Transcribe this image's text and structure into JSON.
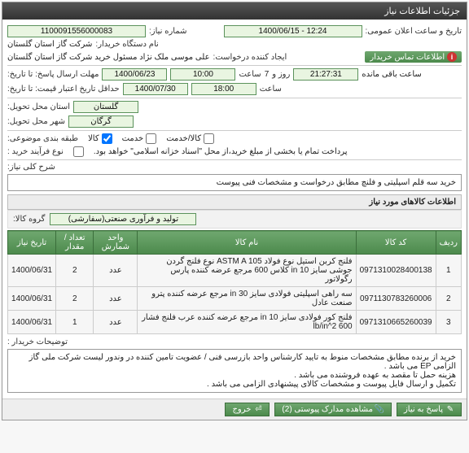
{
  "panel_title": "جزئیات اطلاعات نیاز",
  "fields": {
    "need_no_label": "شماره نیاز:",
    "need_no": "1100091556000083",
    "announce_label": "تاریخ و ساعت اعلان عمومی:",
    "announce_val": "1400/06/15 - 12:24",
    "buyer_org_label": "نام دستگاه خریدار:",
    "buyer_org": "شرکت گاز استان گلستان",
    "creator_label": "ایجاد کننده درخواست:",
    "creator": "علی موسی ملک نژاد مسئول خرید شرکت گاز استان گلستان",
    "contact_btn": "اطلاعات تماس خریدار",
    "reply_deadline_label": "مهلت ارسال پاسخ: تا تاریخ:",
    "reply_date": "1400/06/23",
    "time_label": "ساعت",
    "reply_time": "10:00",
    "day_label": "روز و",
    "days_left": "7",
    "countdown": "21:27:31",
    "remaining": "ساعت باقی مانده",
    "valid_label": "حداقل تاریخ اعتبار قیمت: تا تاریخ:",
    "valid_date": "1400/07/30",
    "valid_time": "18:00",
    "province_label": "استان محل تحویل:",
    "province": "گلستان",
    "city_label": "شهر محل تحویل:",
    "city": "گرگان",
    "classify_label": "طبقه بندی موضوعی:",
    "cb_goods": "کالا",
    "cb_service": "خدمت",
    "cb_both": "کالا/خدمت",
    "process_label": "نوع فرآیند خرید :",
    "process_note": "پرداخت تمام یا بخشی از مبلغ خرید،از محل \"اسناد خزانه اسلامی\" خواهد بود.",
    "desc_label": "شرح کلی نیاز:",
    "desc_text": "خرید سه قلم اسپلیتی و فلنچ مطابق درخواست و مشخصات فنی پیوست",
    "items_header": "اطلاعات کالاهای مورد نیاز",
    "group_label": "گروه کالا:",
    "group_val": "تولید و فرآوری صنعتی(سفارشی)"
  },
  "table": {
    "headers": {
      "row": "ردیف",
      "code": "کد کالا",
      "name": "نام کالا",
      "unit": "واحد شمارش",
      "qty": "تعداد / مقدار",
      "date": "تاریخ نیاز"
    },
    "rows": [
      {
        "idx": "1",
        "code": "0971310028400138",
        "name": "فلنج کربن استیل نوع فولاد ASTM A 105 نوع فلنج گردن جوشی سایز 10 in کلاس 600 مرجع عرضه کننده پارس رگولاتور",
        "unit": "عدد",
        "qty": "2",
        "date": "1400/06/31"
      },
      {
        "idx": "2",
        "code": "0971130783260006",
        "name": "سه راهی اسپلیتی فولادی سایز 30 in مرجع عرضه کننده پترو صنعت عادل",
        "unit": "عدد",
        "qty": "2",
        "date": "1400/06/31"
      },
      {
        "idx": "3",
        "code": "0971310665260039",
        "name": "فلنج کور فولادی سایز 10 in مرجع عرضه کننده عرب فلنج فشار lb/in^2 600",
        "unit": "عدد",
        "qty": "1",
        "date": "1400/06/31"
      }
    ]
  },
  "buyer_note_label": "توضیحات خریدار :",
  "buyer_note": "خرید از برنده مطابق مشخصات منوط به تایید کارشناس واحد بازرسی فنی / عضویت تامین کننده در وندور لیست شرکت ملی گاز الزامی EP می باشد .\nهزینه حمل تا مقصد به عهده فروشنده می باشد .\nتکمیل و ارسال فایل پیوست و مشخصات کالای پیشنهادی الزامی می باشد .",
  "buttons": {
    "reply": "پاسخ به نیاز",
    "attach": "مشاهده مدارک پیوستی (2)",
    "history": "خروج"
  }
}
